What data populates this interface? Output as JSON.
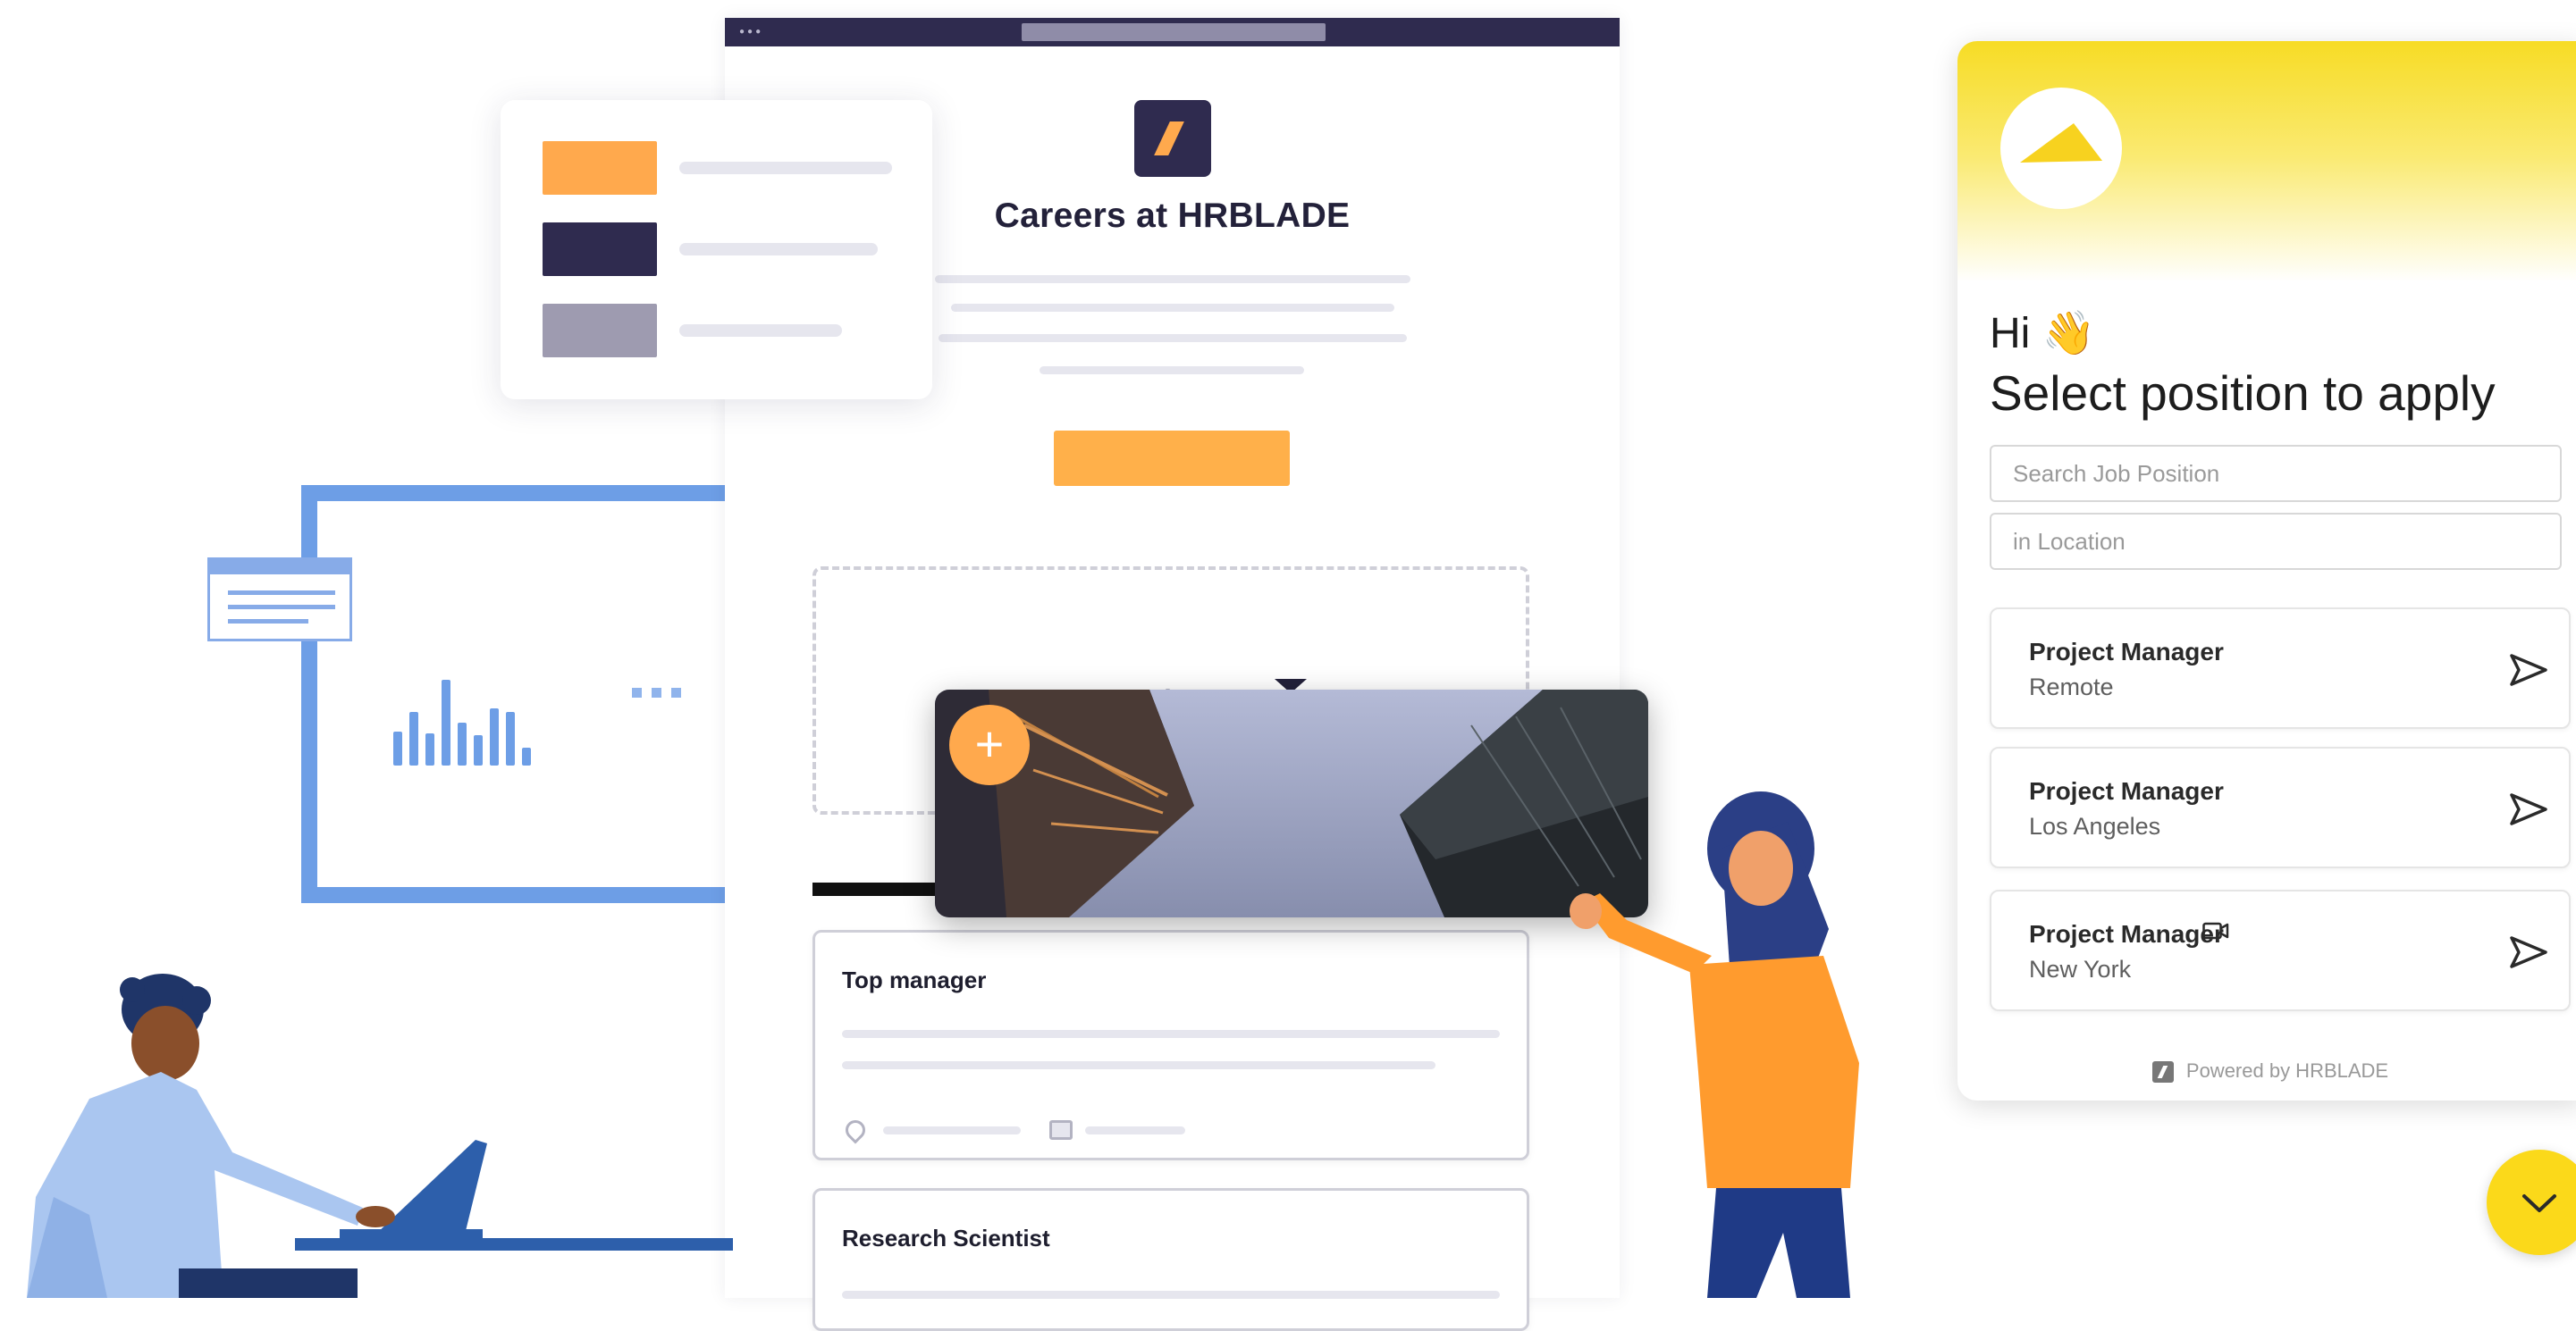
{
  "careers_page": {
    "title": "Careers at HRBLADE",
    "jobs": [
      {
        "title": "Top manager"
      },
      {
        "title": "Research Scientist"
      }
    ]
  },
  "widget": {
    "greeting": "Hi",
    "greeting_emoji": "👋",
    "subtitle": "Select position to apply",
    "search_placeholder": "Search Job Position",
    "location_placeholder": "in Location",
    "positions": [
      {
        "title": "Project Manager",
        "location": "Remote",
        "video": false
      },
      {
        "title": "Project Manager",
        "location": "Los Angeles",
        "video": false
      },
      {
        "title": "Project Manager",
        "location": "New York",
        "video": true
      }
    ],
    "powered_by": "Powered by HRBLADE"
  },
  "colors": {
    "brand_yellow": "#f7dc25",
    "accent_orange": "#ffa94d",
    "dark_navy": "#2f2b4f",
    "illustration_blue": "#6d9ee6"
  },
  "icons": {
    "send": "send-icon",
    "video": "video-icon",
    "toggle": "chevron-down-icon",
    "add": "plus-icon"
  }
}
